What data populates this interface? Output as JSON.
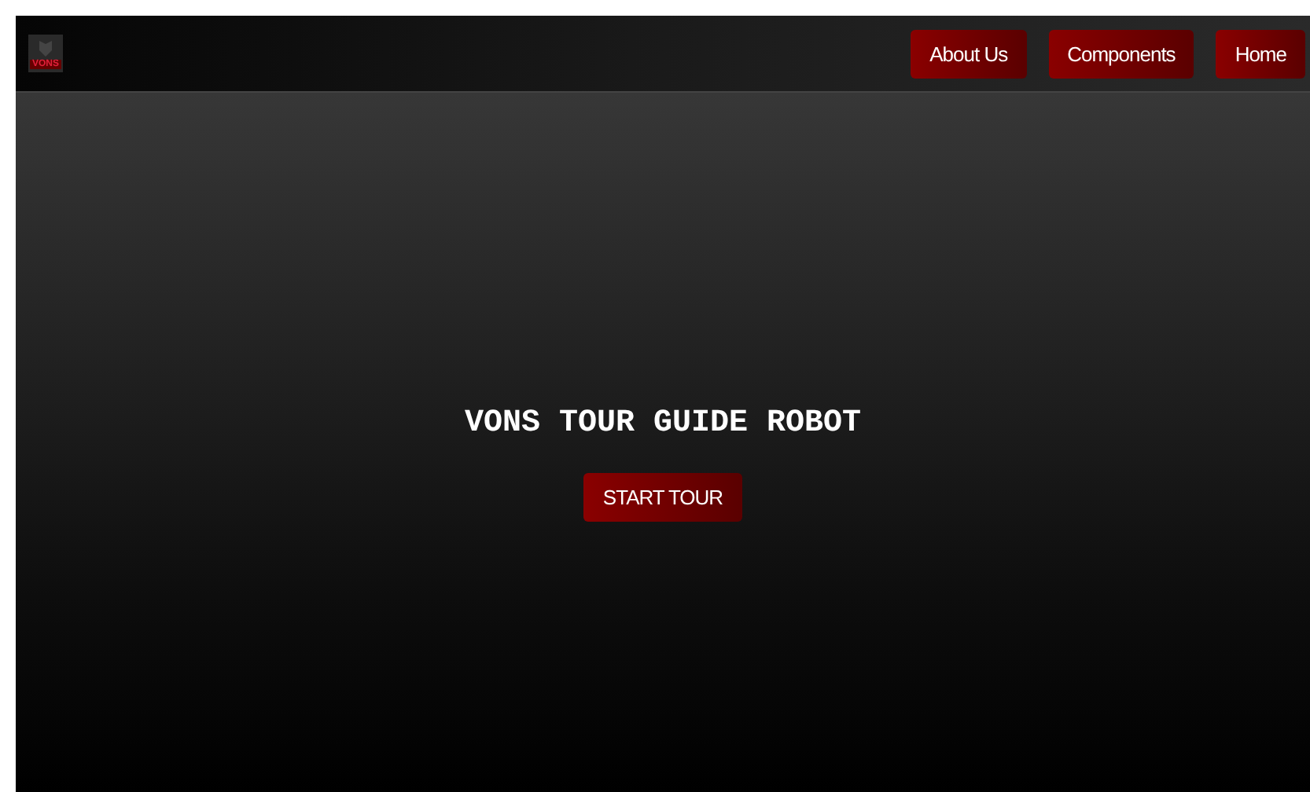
{
  "logo": {
    "text": "VONS"
  },
  "nav": [
    {
      "label": "About Us"
    },
    {
      "label": "Components"
    },
    {
      "label": "Home"
    }
  ],
  "hero": {
    "title": "VONS TOUR GUIDE ROBOT",
    "button": "START TOUR"
  }
}
